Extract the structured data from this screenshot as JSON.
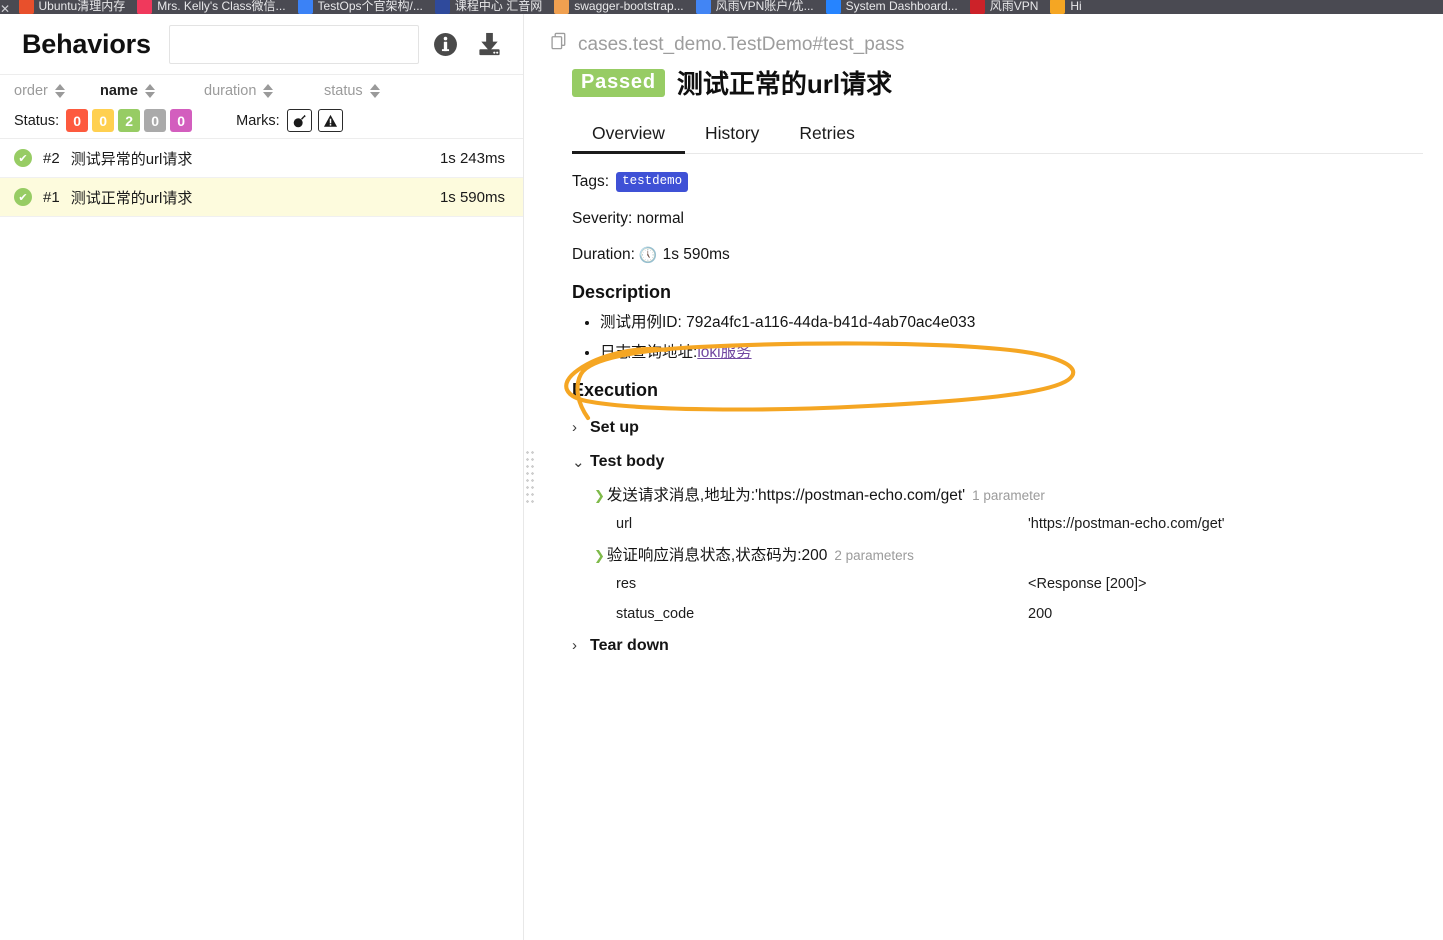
{
  "browser": {
    "tabs": [
      {
        "title": "Ubuntu清理内存",
        "color": "#e8502c"
      },
      {
        "title": "Mrs. Kelly's Class微信...",
        "color": "#f0395c"
      },
      {
        "title": "TestOps个官架构/...",
        "color": "#3b82f6"
      },
      {
        "title": "课程中心 汇音网",
        "color": "#2f4a9c"
      },
      {
        "title": "swagger-bootstrap...",
        "color": "#f0a050"
      },
      {
        "title": "风雨VPN账户/优...",
        "color": "#4285f4"
      },
      {
        "title": "System Dashboard...",
        "color": "#2684ff"
      },
      {
        "title": "风雨VPN",
        "color": "#cc2229"
      },
      {
        "title": "Hi",
        "color": "#f5a623"
      }
    ]
  },
  "left_panel": {
    "title": "Behaviors",
    "search": {
      "value": "",
      "placeholder": ""
    },
    "header_icons": [
      {
        "name": "info-icon",
        "glyph": "i"
      },
      {
        "name": "download-icon",
        "glyph": "download"
      }
    ],
    "sort_columns": [
      {
        "key": "order",
        "label": "order",
        "active": false
      },
      {
        "key": "name",
        "label": "name",
        "active": true
      },
      {
        "key": "duration",
        "label": "duration",
        "active": false
      },
      {
        "key": "status",
        "label": "status",
        "active": false
      }
    ],
    "filters": {
      "status_label": "Status:",
      "status_chips": [
        {
          "count": "0",
          "color": "#fd5a3e",
          "status": "failed"
        },
        {
          "count": "0",
          "color": "#ffd050",
          "status": "broken"
        },
        {
          "count": "2",
          "color": "#97cc64",
          "status": "passed"
        },
        {
          "count": "0",
          "color": "#aaaaaa",
          "status": "skipped"
        },
        {
          "count": "0",
          "color": "#d35ebe",
          "status": "unknown"
        }
      ],
      "marks_label": "Marks:",
      "marks": [
        {
          "name": "flaky-mark",
          "glyph": "💣"
        },
        {
          "name": "warning-mark",
          "glyph": "⚠"
        }
      ]
    },
    "tests": [
      {
        "order": "#2",
        "name": "测试异常的url请求",
        "duration": "1s 243ms",
        "status": "passed",
        "selected": false
      },
      {
        "order": "#1",
        "name": "测试正常的url请求",
        "duration": "1s 590ms",
        "status": "passed",
        "selected": true
      }
    ]
  },
  "detail": {
    "breadcrumb": "cases.test_demo.TestDemo#test_pass",
    "status_label": "Passed",
    "status_color": "#97cc64",
    "title": "测试正常的url请求",
    "tabs": [
      {
        "label": "Overview",
        "active": true
      },
      {
        "label": "History",
        "active": false
      },
      {
        "label": "Retries",
        "active": false
      }
    ],
    "meta": {
      "tags_label": "Tags:",
      "tags": [
        "testdemo"
      ],
      "tag_color": "#3f51d6",
      "severity_label": "Severity:",
      "severity_value": "normal",
      "duration_label": "Duration:",
      "duration_value": "1s 590ms"
    },
    "description": {
      "heading": "Description",
      "items": [
        {
          "text": "测试用例ID: 792a4fc1-a116-44da-b41d-4ab70ac4e033",
          "link": null
        },
        {
          "text": "日志查询地址:",
          "link": "loki服务"
        }
      ]
    },
    "execution": {
      "heading": "Execution",
      "groups": [
        {
          "label": "Set up",
          "expanded": false,
          "steps": []
        },
        {
          "label": "Test body",
          "expanded": true,
          "steps": [
            {
              "label": "发送请求消息,地址为:'https://postman-echo.com/get'",
              "count": "1 parameter",
              "params": [
                {
                  "name": "url",
                  "value": "'https://postman-echo.com/get'"
                }
              ]
            },
            {
              "label": "验证响应消息状态,状态码为:200",
              "count": "2 parameters",
              "params": [
                {
                  "name": "res",
                  "value": "<Response [200]>"
                },
                {
                  "name": "status_code",
                  "value": "200"
                }
              ]
            }
          ]
        },
        {
          "label": "Tear down",
          "expanded": false,
          "steps": []
        }
      ]
    },
    "annotation": {
      "shape": "hand-drawn-ellipse",
      "color": "#f5a623"
    }
  }
}
